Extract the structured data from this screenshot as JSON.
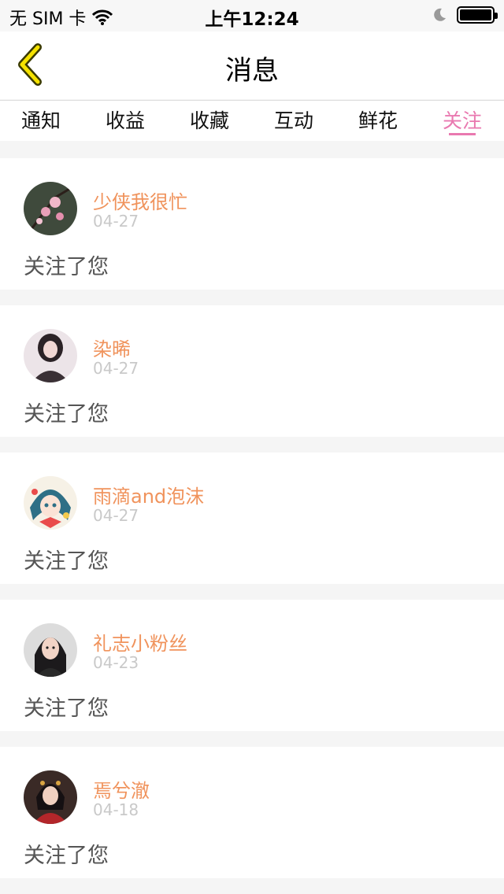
{
  "status_bar": {
    "carrier": "无 SIM 卡",
    "time": "上午12:24"
  },
  "nav": {
    "title": "消息"
  },
  "tabs": [
    {
      "label": "通知",
      "active": false
    },
    {
      "label": "收益",
      "active": false
    },
    {
      "label": "收藏",
      "active": false
    },
    {
      "label": "互动",
      "active": false
    },
    {
      "label": "鲜花",
      "active": false
    },
    {
      "label": "关注",
      "active": true
    }
  ],
  "notifications": [
    {
      "name": "少侠我很忙",
      "date": "04-27",
      "action": "关注了您",
      "avatar_icon": "plum-blossom-avatar"
    },
    {
      "name": "染晞",
      "date": "04-27",
      "action": "关注了您",
      "avatar_icon": "girl-avatar"
    },
    {
      "name": "雨滴and泡沫",
      "date": "04-27",
      "action": "关注了您",
      "avatar_icon": "anime-avatar"
    },
    {
      "name": "礼志小粉丝",
      "date": "04-23",
      "action": "关注了您",
      "avatar_icon": "woman-avatar"
    },
    {
      "name": "焉兮澈",
      "date": "04-18",
      "action": "关注了您",
      "avatar_icon": "costume-avatar"
    }
  ],
  "colors": {
    "accent": "#e979b0",
    "name": "#f0935c",
    "date": "#c9c9c9",
    "back_arrow": "#f5e200"
  }
}
